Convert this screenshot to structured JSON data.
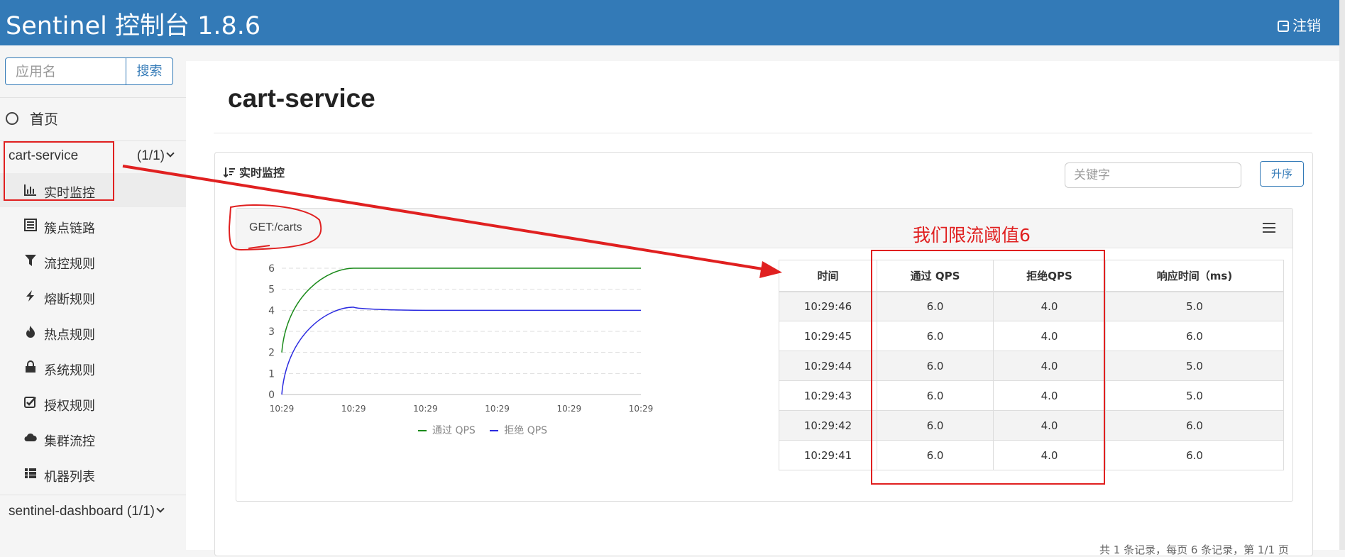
{
  "header": {
    "brand": "Sentinel 控制台 1.8.6",
    "logout_label": "注销"
  },
  "sidebar": {
    "search_placeholder": "应用名",
    "search_button": "搜索",
    "home_label": "首页",
    "app": {
      "name": "cart-service",
      "count": "(1/1)"
    },
    "menu": [
      {
        "label": "实时监控",
        "icon": "bar-chart-icon",
        "active": true
      },
      {
        "label": "簇点链路",
        "icon": "list-icon"
      },
      {
        "label": "流控规则",
        "icon": "filter-icon"
      },
      {
        "label": "熔断规则",
        "icon": "bolt-icon"
      },
      {
        "label": "热点规则",
        "icon": "flame-icon"
      },
      {
        "label": "系统规则",
        "icon": "lock-icon"
      },
      {
        "label": "授权规则",
        "icon": "check-square-icon"
      },
      {
        "label": "集群流控",
        "icon": "cloud-icon"
      },
      {
        "label": "机器列表",
        "icon": "grid-list-icon"
      }
    ],
    "app2": {
      "name": "sentinel-dashboard",
      "count": "(1/1)"
    }
  },
  "main": {
    "title": "cart-service",
    "panel_title": "实时监控",
    "keyword_placeholder": "关键字",
    "sort_button": "升序",
    "resource": {
      "name": "GET:/carts"
    },
    "table": {
      "headers": [
        "时间",
        "通过 QPS",
        "拒绝QPS",
        "响应时间（ms)"
      ],
      "rows": [
        [
          "10:29:46",
          "6.0",
          "4.0",
          "5.0"
        ],
        [
          "10:29:45",
          "6.0",
          "4.0",
          "6.0"
        ],
        [
          "10:29:44",
          "6.0",
          "4.0",
          "5.0"
        ],
        [
          "10:29:43",
          "6.0",
          "4.0",
          "5.0"
        ],
        [
          "10:29:42",
          "6.0",
          "4.0",
          "6.0"
        ],
        [
          "10:29:41",
          "6.0",
          "4.0",
          "6.0"
        ]
      ]
    },
    "pager_text": "共 1 条记录，每页 6 条记录，第 1/1 页"
  },
  "annotation": {
    "text": "我们限流阈值6",
    "color": "#e02020"
  },
  "colors": {
    "header": "#337ab7",
    "pass": "#1a8a1a",
    "block": "#2a2ae0"
  },
  "chart_data": {
    "type": "line",
    "x": [
      "10:29",
      "10:29",
      "10:29",
      "10:29",
      "10:29",
      "10:29"
    ],
    "ylim": [
      0,
      6
    ],
    "yticks": [
      0,
      1,
      2,
      3,
      4,
      5,
      6
    ],
    "legend_position": "bottom",
    "series": [
      {
        "name": "通过 QPS",
        "color": "#1a8a1a",
        "values": [
          2,
          6,
          6,
          6,
          6,
          6
        ]
      },
      {
        "name": "拒绝 QPS",
        "color": "#2a2ae0",
        "values": [
          0,
          4.15,
          4,
          4,
          4,
          4
        ]
      }
    ]
  }
}
